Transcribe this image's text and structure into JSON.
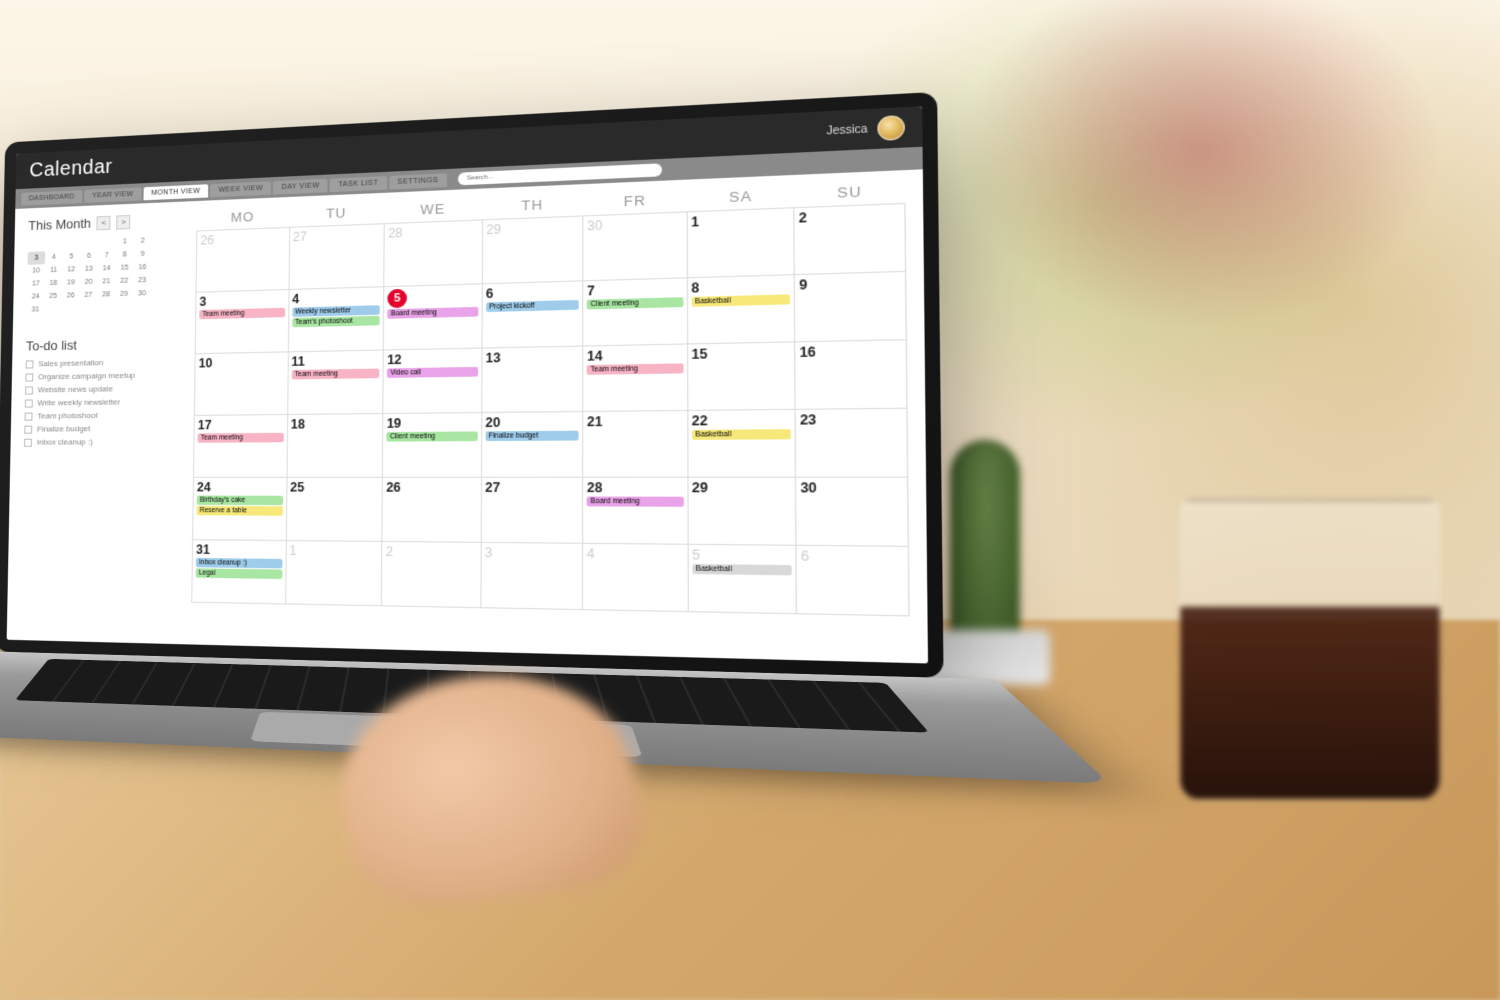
{
  "header": {
    "title": "Calendar",
    "user_name": "Jessica"
  },
  "nav": {
    "tabs": [
      "DASHBOARD",
      "YEAR VIEW",
      "MONTH VIEW",
      "WEEK VIEW",
      "DAY VIEW",
      "TASK LIST",
      "SETTINGS"
    ],
    "active_index": 2,
    "search_placeholder": "Search..."
  },
  "sidebar": {
    "mini_title": "This Month",
    "prev_glyph": "<",
    "next_glyph": ">",
    "mini_days": [
      [
        "",
        "",
        "",
        "",
        "",
        "1",
        "2"
      ],
      [
        "3",
        "4",
        "5",
        "6",
        "7",
        "8",
        "9"
      ],
      [
        "10",
        "11",
        "12",
        "13",
        "14",
        "15",
        "16"
      ],
      [
        "17",
        "18",
        "19",
        "20",
        "21",
        "22",
        "23"
      ],
      [
        "24",
        "25",
        "26",
        "27",
        "28",
        "29",
        "30"
      ],
      [
        "31",
        "",
        "",
        "",
        "",
        "",
        ""
      ]
    ],
    "mini_selected": "3",
    "todo_title": "To-do list",
    "todo_items": [
      "Sales presentation",
      "Organize campaign meetup",
      "Website news update",
      "Write weekly newsletter",
      "Team photoshoot",
      "Finalize budget",
      "Inbox cleanup :)"
    ]
  },
  "calendar": {
    "dow": [
      "MO",
      "TU",
      "WE",
      "TH",
      "FR",
      "SA",
      "SU"
    ],
    "today": 5,
    "cells": [
      {
        "n": 26,
        "prev": true
      },
      {
        "n": 27,
        "prev": true
      },
      {
        "n": 28,
        "prev": true
      },
      {
        "n": 29,
        "prev": true
      },
      {
        "n": 30,
        "prev": true
      },
      {
        "n": 1
      },
      {
        "n": 2
      },
      {
        "n": 3,
        "events": [
          {
            "t": "Team meeting",
            "c": "pink"
          }
        ]
      },
      {
        "n": 4,
        "events": [
          {
            "t": "Weekly newsletter",
            "c": "blue"
          },
          {
            "t": "Team's photoshoot",
            "c": "green"
          }
        ]
      },
      {
        "n": 5,
        "today": true,
        "events": [
          {
            "t": "Board meeting",
            "c": "magenta"
          }
        ]
      },
      {
        "n": 6,
        "events": [
          {
            "t": "Project kickoff",
            "c": "blue"
          }
        ]
      },
      {
        "n": 7,
        "events": [
          {
            "t": "Client meeting",
            "c": "green"
          }
        ]
      },
      {
        "n": 8,
        "events": [
          {
            "t": "Basketball",
            "c": "yellow"
          }
        ]
      },
      {
        "n": 9
      },
      {
        "n": 10
      },
      {
        "n": 11,
        "events": [
          {
            "t": "Team meeting",
            "c": "pink"
          }
        ]
      },
      {
        "n": 12,
        "events": [
          {
            "t": "Video call",
            "c": "magenta"
          }
        ]
      },
      {
        "n": 13
      },
      {
        "n": 14,
        "events": [
          {
            "t": "Team meeting",
            "c": "pink"
          }
        ]
      },
      {
        "n": 15
      },
      {
        "n": 16
      },
      {
        "n": 17,
        "events": [
          {
            "t": "Team meeting",
            "c": "pink"
          }
        ]
      },
      {
        "n": 18
      },
      {
        "n": 19,
        "events": [
          {
            "t": "Client meeting",
            "c": "green"
          }
        ]
      },
      {
        "n": 20,
        "events": [
          {
            "t": "Finalize budget",
            "c": "blue"
          }
        ]
      },
      {
        "n": 21
      },
      {
        "n": 22,
        "events": [
          {
            "t": "Basketball",
            "c": "yellow"
          }
        ]
      },
      {
        "n": 23
      },
      {
        "n": 24,
        "events": [
          {
            "t": "Birthday's cake",
            "c": "green"
          },
          {
            "t": "Reserve a table",
            "c": "yellow"
          }
        ]
      },
      {
        "n": 25
      },
      {
        "n": 26
      },
      {
        "n": 27
      },
      {
        "n": 28,
        "events": [
          {
            "t": "Board meeting",
            "c": "magenta"
          }
        ]
      },
      {
        "n": 29
      },
      {
        "n": 30
      },
      {
        "n": 31,
        "events": [
          {
            "t": "Inbox cleanup :)",
            "c": "blue"
          },
          {
            "t": "Legal",
            "c": "green"
          }
        ]
      },
      {
        "n": 1,
        "next": true
      },
      {
        "n": 2,
        "next": true
      },
      {
        "n": 3,
        "next": true
      },
      {
        "n": 4,
        "next": true
      },
      {
        "n": 5,
        "next": true,
        "events": [
          {
            "t": "Basketball",
            "c": "grey"
          }
        ]
      },
      {
        "n": 6,
        "next": true
      }
    ]
  },
  "colors": {
    "pink": "#f8b4c4",
    "blue": "#9fcceb",
    "green": "#a9e6a3",
    "yellow": "#f6e97a",
    "magenta": "#e9a3e8",
    "grey": "#d8d8d8",
    "today": "#e4002b"
  }
}
